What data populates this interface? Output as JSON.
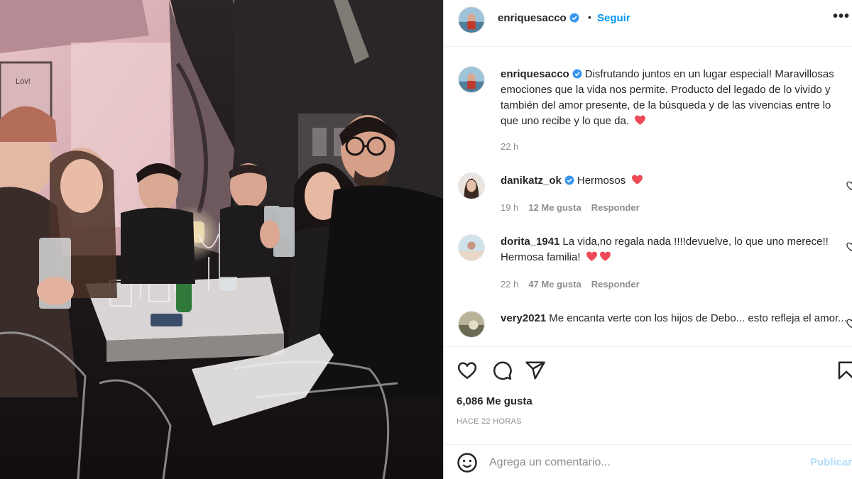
{
  "post": {
    "username": "enriquesacco",
    "follow_label": "Seguir",
    "more_label": "•••",
    "separator": "•",
    "caption": {
      "username": "enriquesacco",
      "text": "Disfrutando juntos en un lugar especial! Maravillosas emociones que la vida nos permite. Producto del legado de lo vivido y también del amor presente, de la búsqueda y de las vivencias entre lo que uno recibe y lo que da.",
      "time": "22 h"
    },
    "comments": [
      {
        "username": "danikatz_ok",
        "verified": true,
        "text": "Hermosos",
        "time": "19 h",
        "likes": "12 Me gusta",
        "reply": "Responder"
      },
      {
        "username": "dorita_1941",
        "verified": false,
        "text": "La vida,no regala nada !!!!devuelve, lo que uno merece!! Hermosa familia!",
        "time": "22 h",
        "likes": "47 Me gusta",
        "reply": "Responder"
      },
      {
        "username": "very2021",
        "verified": false,
        "text": "Me encanta verte con los hijos de Debo... esto refleja el amor...",
        "time": "",
        "likes": "",
        "reply": ""
      }
    ],
    "like_count": "6,086 Me gusta",
    "posted_ago": "HACE 22 HORAS",
    "comment_placeholder": "Agrega un comentario...",
    "publish_label": "Publicar",
    "photo_sign_text": "Lov!"
  },
  "colors": {
    "accent": "#0095f6",
    "verified": "#3897f0",
    "heart": "#ed4956",
    "muted": "#8e8e8e",
    "publish_disabled": "#b2dffc"
  },
  "icons": [
    "verified-badge-icon",
    "heart-icon",
    "comment-icon",
    "share-icon",
    "bookmark-icon",
    "emoji-icon",
    "more-options-icon"
  ]
}
